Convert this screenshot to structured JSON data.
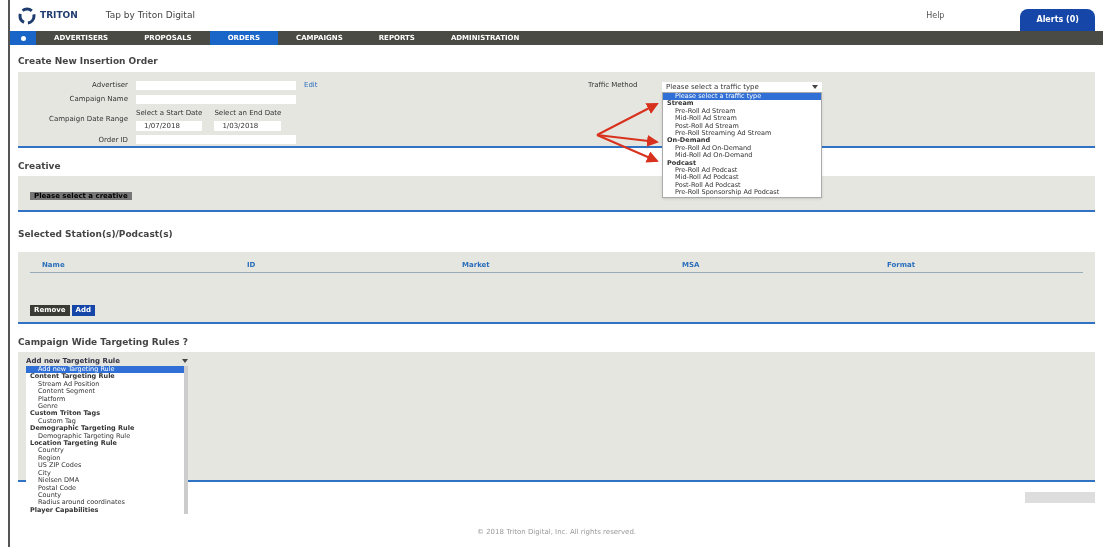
{
  "header": {
    "logo": "TRITON",
    "app_title": "Tap by Triton Digital",
    "help": "Help",
    "alerts": "Alerts (0)"
  },
  "nav": [
    {
      "label": "ADVERTISERS",
      "selected": false
    },
    {
      "label": "PROPOSALS",
      "selected": false
    },
    {
      "label": "ORDERS",
      "selected": true
    },
    {
      "label": "CAMPAIGNS",
      "selected": false
    },
    {
      "label": "REPORTS",
      "selected": false
    },
    {
      "label": "ADMINISTRATION",
      "selected": false
    }
  ],
  "order": {
    "title": "Create New Insertion Order",
    "advertiser_label": "Advertiser",
    "edit": "Edit",
    "campaign_name_label": "Campaign Name",
    "date_range_label": "Campaign Date Range",
    "start_hint": "Select a Start Date",
    "end_hint": "Select an End Date",
    "start": "1/07/2018",
    "end": "1/03/2018",
    "po_label": "Order ID",
    "traffic_label": "Traffic Method",
    "traffic_value": "Please select a traffic type"
  },
  "traffic_menu": [
    {
      "label": "Please select a traffic type",
      "kind": "option",
      "selected": true
    },
    {
      "label": "Stream",
      "kind": "group",
      "selected": false
    },
    {
      "label": "Pre-Roll Ad Stream",
      "kind": "option",
      "selected": false
    },
    {
      "label": "Mid-Roll Ad Stream",
      "kind": "option",
      "selected": false
    },
    {
      "label": "Post-Roll Ad Stream",
      "kind": "option",
      "selected": false
    },
    {
      "label": "Pre-Roll Streaming Ad Stream",
      "kind": "option",
      "selected": false
    },
    {
      "label": "On-Demand",
      "kind": "group",
      "selected": false
    },
    {
      "label": "Pre-Roll Ad On-Demand",
      "kind": "option",
      "selected": false
    },
    {
      "label": "Mid-Roll Ad On-Demand",
      "kind": "option",
      "selected": false
    },
    {
      "label": "Podcast",
      "kind": "group",
      "selected": false
    },
    {
      "label": "Pre-Roll Ad Podcast",
      "kind": "option",
      "selected": false
    },
    {
      "label": "Mid-Roll Ad Podcast",
      "kind": "option",
      "selected": false
    },
    {
      "label": "Post-Roll Ad Podcast",
      "kind": "option",
      "selected": false
    },
    {
      "label": "Pre-Roll Sponsorship Ad Podcast",
      "kind": "option",
      "selected": false
    }
  ],
  "creative": {
    "title": "Creative",
    "hint": "Please select a creative"
  },
  "stations": {
    "title": "Selected Station(s)/Podcast(s)",
    "columns": [
      "Name",
      "ID",
      "Market",
      "MSA",
      "Format"
    ],
    "remove": "Remove",
    "add": "Add"
  },
  "targeting": {
    "title": "Campaign Wide Targeting Rules ?",
    "select": "Add new Targeting Rule",
    "items": [
      {
        "label": "Add new Targeting Rule",
        "kind": "option",
        "selected": true
      },
      {
        "label": "Content Targeting Rule",
        "kind": "group",
        "selected": false
      },
      {
        "label": "Stream Ad Position",
        "kind": "option",
        "selected": false
      },
      {
        "label": "Content Segment",
        "kind": "option",
        "selected": false
      },
      {
        "label": "Platform",
        "kind": "option",
        "selected": false
      },
      {
        "label": "Genre",
        "kind": "option",
        "selected": false
      },
      {
        "label": "Custom Triton Tags",
        "kind": "group",
        "selected": false
      },
      {
        "label": "Custom Tag",
        "kind": "option",
        "selected": false
      },
      {
        "label": "Demographic Targeting Rule",
        "kind": "group",
        "selected": false
      },
      {
        "label": "Demographic Targeting Rule",
        "kind": "option",
        "selected": false
      },
      {
        "label": "Location Targeting Rule",
        "kind": "group",
        "selected": false
      },
      {
        "label": "Country",
        "kind": "option",
        "selected": false
      },
      {
        "label": "Region",
        "kind": "option",
        "selected": false
      },
      {
        "label": "US ZIP Codes",
        "kind": "option",
        "selected": false
      },
      {
        "label": "City",
        "kind": "option",
        "selected": false
      },
      {
        "label": "Nielsen DMA",
        "kind": "option",
        "selected": false
      },
      {
        "label": "Postal Code",
        "kind": "option",
        "selected": false
      },
      {
        "label": "County",
        "kind": "option",
        "selected": false
      },
      {
        "label": "Radius around coordinates",
        "kind": "option",
        "selected": false
      },
      {
        "label": "Player Capabilities",
        "kind": "group",
        "selected": false
      }
    ]
  },
  "footer": "© 2018 Triton Digital, Inc. All rights reserved."
}
